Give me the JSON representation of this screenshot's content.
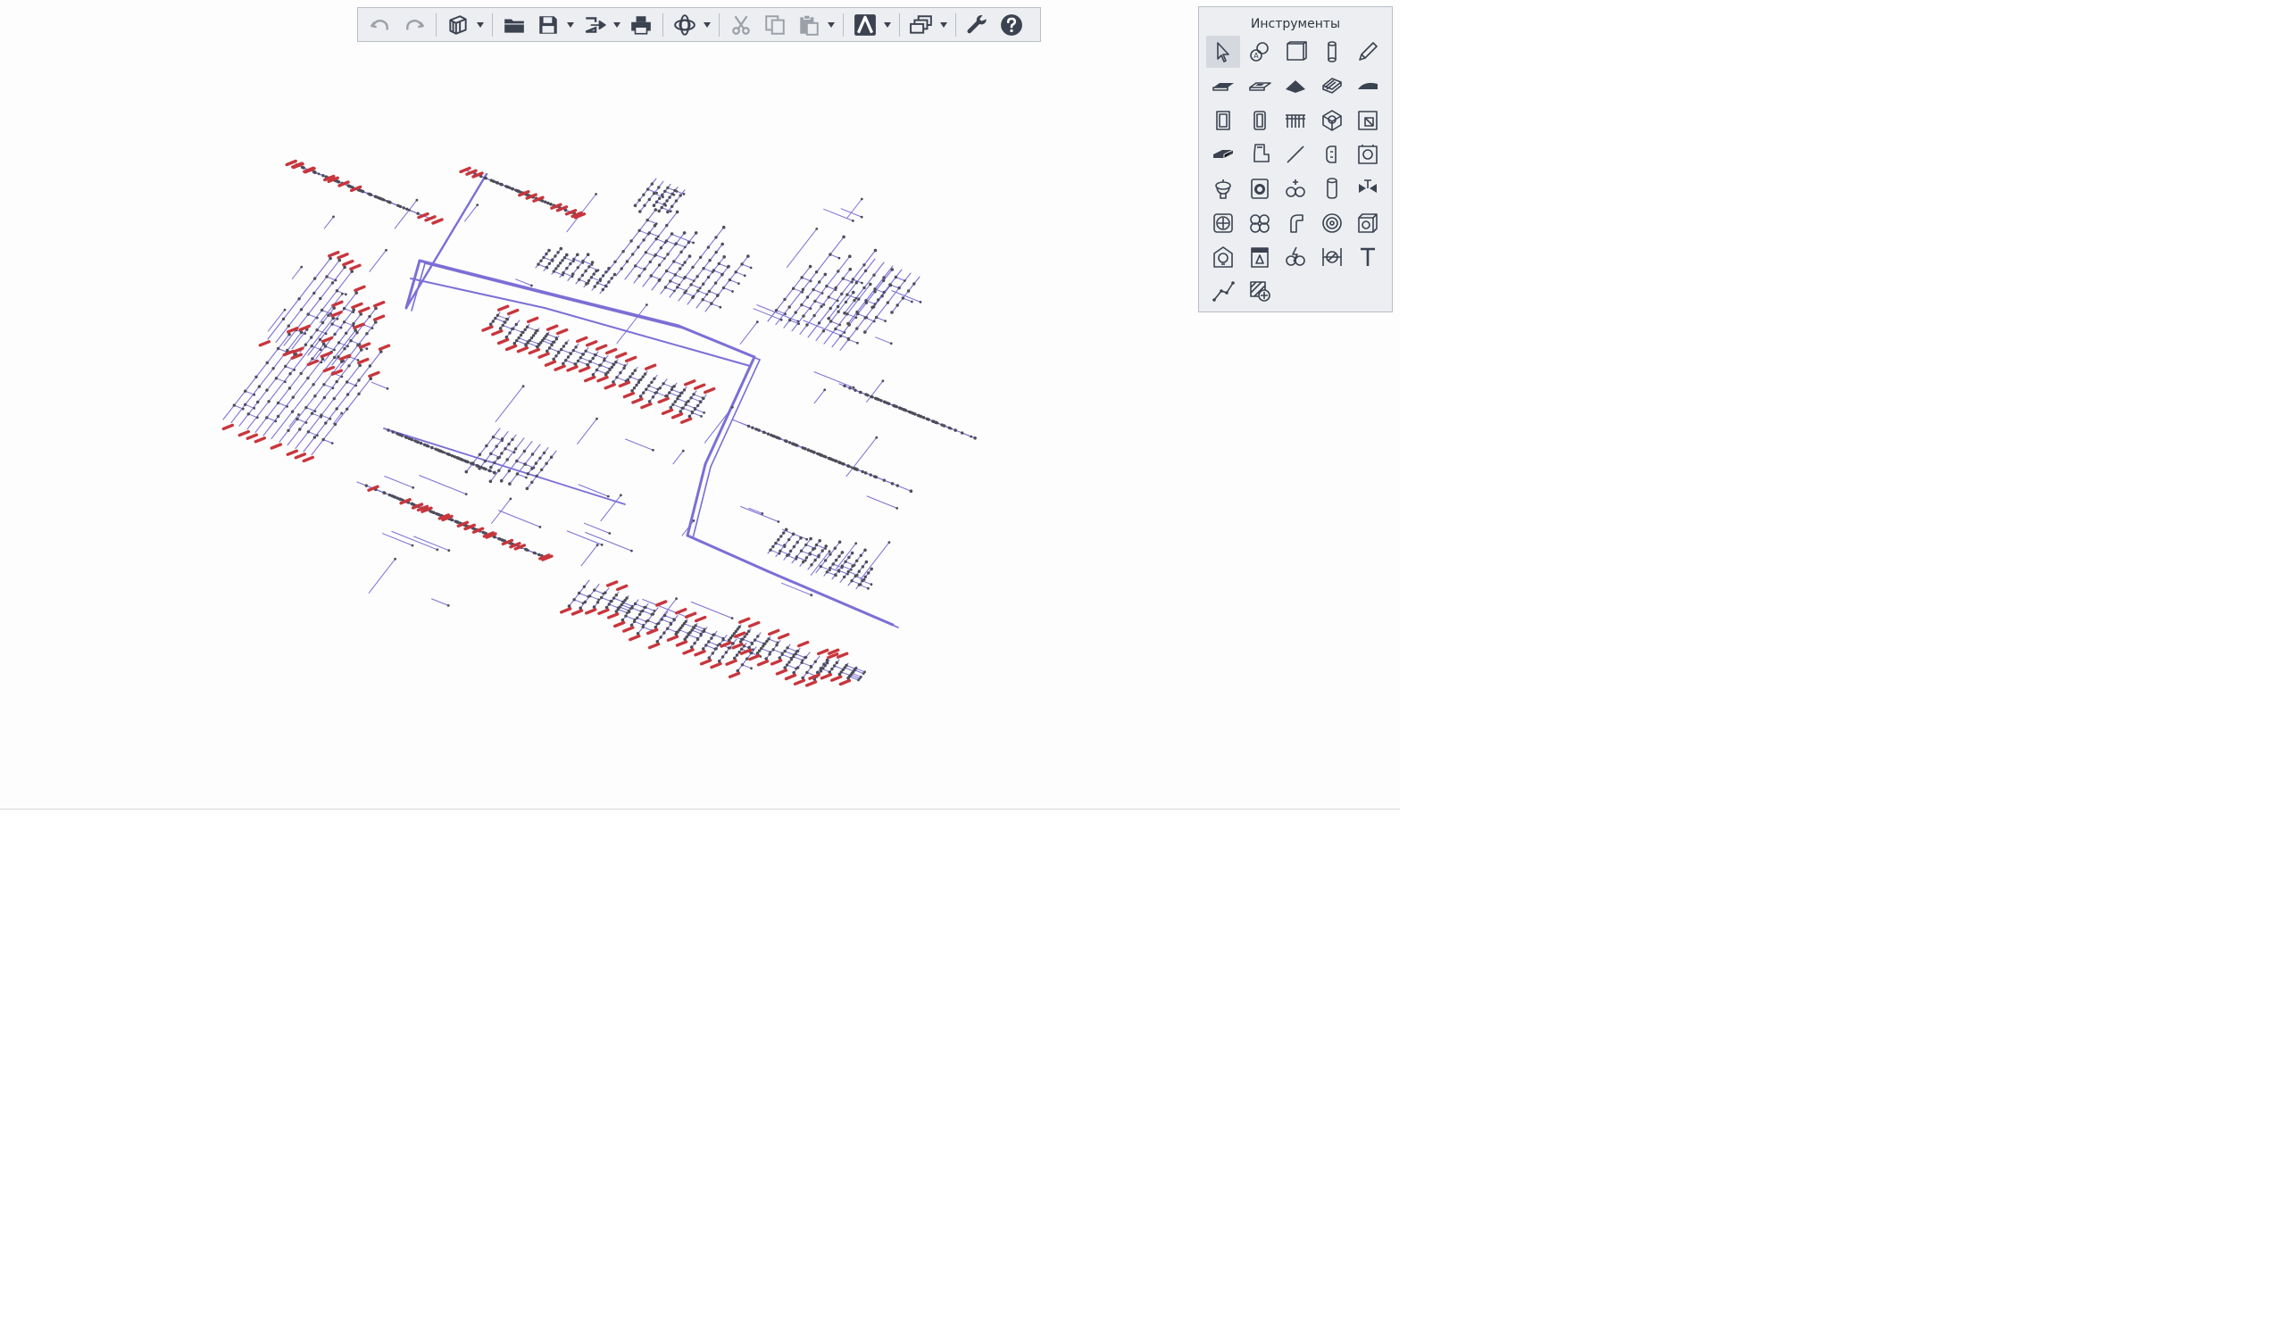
{
  "toolbar": {
    "buttons": [
      {
        "id": "undo",
        "icon": "undo-icon",
        "enabled": false
      },
      {
        "id": "redo",
        "icon": "redo-icon",
        "enabled": false
      },
      {
        "id": "view3d",
        "icon": "3d-view-icon",
        "enabled": true
      },
      {
        "id": "open",
        "icon": "folder-open-icon",
        "enabled": true
      },
      {
        "id": "save",
        "icon": "save-icon",
        "enabled": true
      },
      {
        "id": "export",
        "icon": "export-icon",
        "enabled": true
      },
      {
        "id": "print",
        "icon": "print-icon",
        "enabled": true
      },
      {
        "id": "orbit",
        "icon": "orbit-icon",
        "enabled": true
      },
      {
        "id": "cut",
        "icon": "scissors-icon",
        "enabled": false
      },
      {
        "id": "copy",
        "icon": "copy-icon",
        "enabled": false
      },
      {
        "id": "paste",
        "icon": "paste-icon",
        "enabled": false
      },
      {
        "id": "snap",
        "icon": "snap-icon",
        "enabled": true
      },
      {
        "id": "layers",
        "icon": "layers-icon",
        "enabled": true
      },
      {
        "id": "settings",
        "icon": "wrench-icon",
        "enabled": true
      },
      {
        "id": "help",
        "icon": "help-icon",
        "enabled": true
      }
    ]
  },
  "tools_panel": {
    "title": "Инструменты",
    "active_tool": "select-tool",
    "tools": [
      "select-tool",
      "object-tool",
      "wall-tool",
      "column-tool",
      "pencil-tool",
      "slab-tool",
      "slab-opening-tool",
      "roof-tool",
      "stairs-tool",
      "ramp-tool",
      "door-tool",
      "window-tool",
      "railing-tool",
      "object-3d-tool",
      "opening-tool",
      "duct-tool",
      "duct-fitting-tool",
      "line-tool",
      "pipe-fitting-tool",
      "boiler-tool",
      "sink-tool",
      "washer-tool",
      "pump-tool",
      "pipe-tool",
      "valve-tool",
      "fan-tool",
      "radiator-tool",
      "duct-bend-tool",
      "coil-tool",
      "tank-tool",
      "lamp-tool",
      "switchboard-tool",
      "electric-tool",
      "dimension-tool",
      "text-tool",
      "polyline-tool",
      "hatch-tool"
    ]
  },
  "colors": {
    "background": "#fdfdfd",
    "panel": "#eceef1",
    "panel_border": "#b9bec6",
    "icon": "#3b4250",
    "pipe": "#7b6fd6",
    "node": "#4d4d5a",
    "terminal": "#c8363d"
  }
}
